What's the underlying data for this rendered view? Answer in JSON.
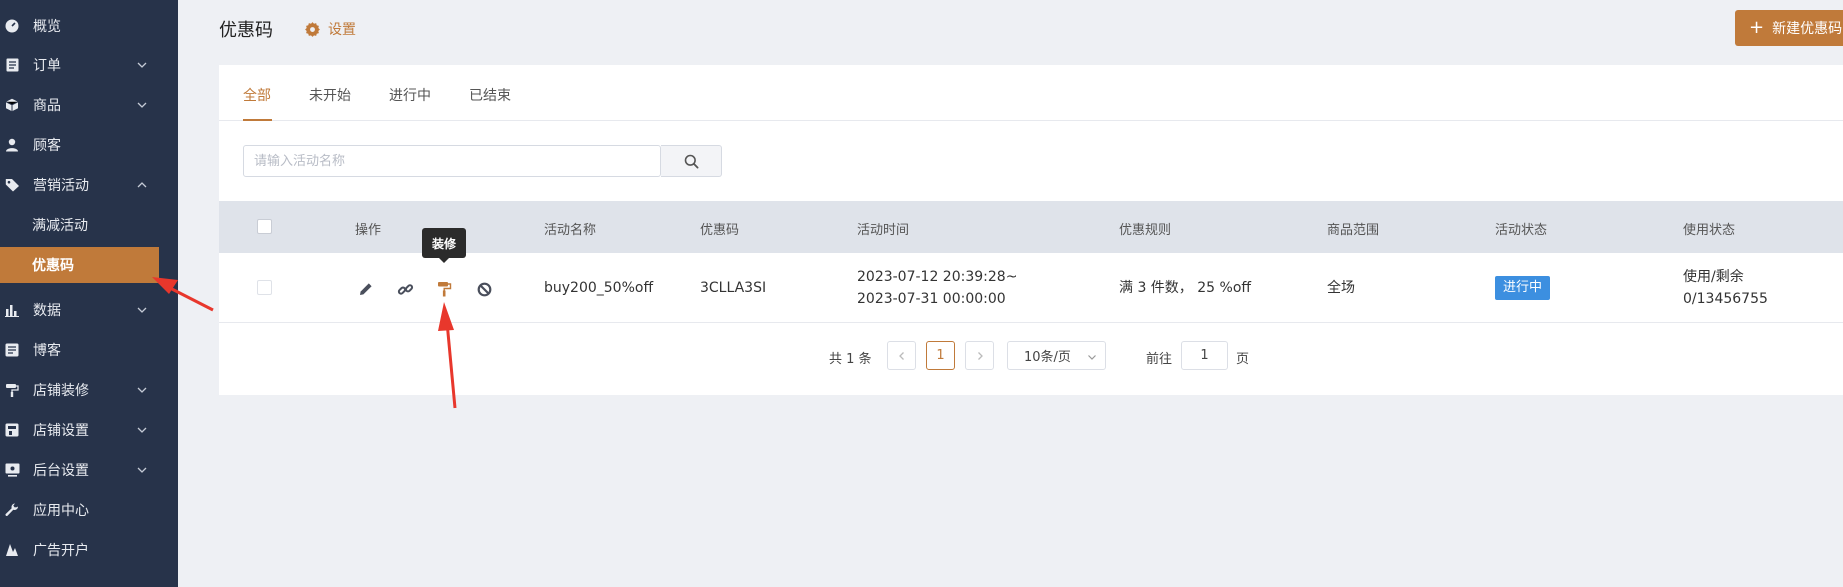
{
  "sidebar": {
    "items": [
      {
        "label": "概览",
        "icon": "gauge-icon"
      },
      {
        "label": "订单",
        "icon": "order-icon"
      },
      {
        "label": "商品",
        "icon": "cube-icon"
      },
      {
        "label": "顾客",
        "icon": "user-icon"
      },
      {
        "label": "营销活动",
        "icon": "tag-icon"
      },
      {
        "label": "满减活动"
      },
      {
        "label": "优惠码"
      },
      {
        "label": "数据",
        "icon": "bar-chart-icon"
      },
      {
        "label": "博客",
        "icon": "blog-icon"
      },
      {
        "label": "店铺装修",
        "icon": "paint-roller-icon"
      },
      {
        "label": "店铺设置",
        "icon": "store-icon"
      },
      {
        "label": "后台设置",
        "icon": "monitor-icon"
      },
      {
        "label": "应用中心",
        "icon": "wrench-icon"
      },
      {
        "label": "广告开户",
        "icon": "ads-icon"
      }
    ]
  },
  "header": {
    "title": "优惠码",
    "settings_label": "设置",
    "new_button_label": "新建优惠码"
  },
  "tabs": [
    "全部",
    "未开始",
    "进行中",
    "已结束"
  ],
  "search": {
    "placeholder": "请输入活动名称"
  },
  "table": {
    "columns": [
      "操作",
      "活动名称",
      "优惠码",
      "活动时间",
      "优惠规则",
      "商品范围",
      "活动状态",
      "使用状态"
    ],
    "rows": [
      {
        "name": "buy200_50%off",
        "code": "3CLLA3SI",
        "time_start": "2023-07-12 20:39:28~",
        "time_end": "2023-07-31 00:00:00",
        "rule": "满 3 件数， 25 %off",
        "scope": "全场",
        "status": "进行中",
        "usage_label": "使用/剩余",
        "usage_value": "0/13456755"
      }
    ]
  },
  "tooltip": "装修",
  "pagination": {
    "total": "共 1 条",
    "current_page": "1",
    "page_size": "10条/页",
    "goto_label": "前往",
    "goto_value": "1",
    "page_suffix": "页"
  },
  "colors": {
    "sidebar_bg": "#27334a",
    "accent": "#c07a3a",
    "status_blue": "#3c8fe0",
    "annotation_red": "#e8372c"
  }
}
